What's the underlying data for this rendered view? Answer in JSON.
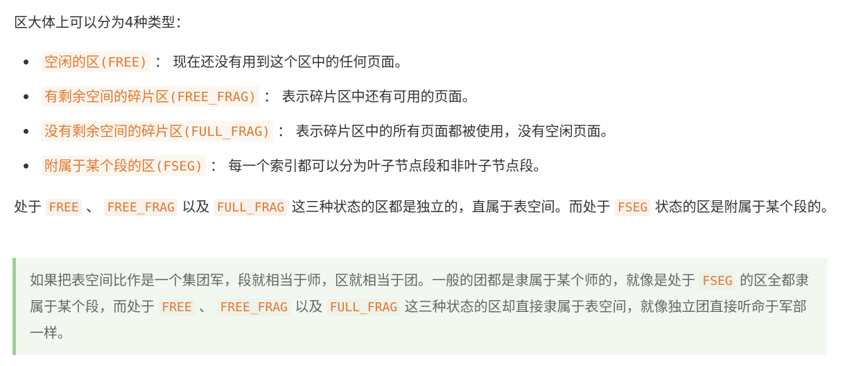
{
  "intro": "区大体上可以分为4种类型：",
  "types": [
    {
      "term_cn": "空闲的区",
      "term_code": "FREE",
      "separator": "：",
      "desc": "现在还没有用到这个区中的任何页面。"
    },
    {
      "term_cn": "有剩余空间的碎片区",
      "term_code": "FREE_FRAG",
      "separator": "：",
      "desc": "表示碎片区中还有可用的页面。"
    },
    {
      "term_cn": "没有剩余空间的碎片区",
      "term_code": "FULL_FRAG",
      "separator": "：",
      "desc": "表示碎片区中的所有页面都被使用，没有空闲页面。"
    },
    {
      "term_cn": "附属于某个段的区",
      "term_code": "FSEG",
      "separator": "：",
      "desc": "每一个索引都可以分为叶子节点段和非叶子节点段。"
    }
  ],
  "paragraph": {
    "t1": "处于",
    "c1": "FREE",
    "t2": "、",
    "c2": "FREE_FRAG",
    "t3": "以及",
    "c3": "FULL_FRAG",
    "t4": "这三种状态的区都是独立的，直属于表空间。而处于",
    "c4": "FSEG",
    "t5": "状态的区是附属于某个段的。"
  },
  "quote": {
    "t1": "如果把表空间比作是一个集团军，段就相当于师，区就相当于团。一般的团都是隶属于某个师的，就像是处于",
    "c1": "FSEG",
    "t2": "的区全都隶属于某个段，而处于",
    "c2": "FREE",
    "t3": "、",
    "c3": "FREE_FRAG",
    "t4": "以及",
    "c4": "FULL_FRAG",
    "t5": "这三种状态的区却直接隶属于表空间，就像独立团直接听命于军部一样。"
  },
  "colors": {
    "text": "#333333",
    "code": "#e3762d",
    "quote_border": "#9fcf9a",
    "quote_bg": "#f2f7f0"
  }
}
